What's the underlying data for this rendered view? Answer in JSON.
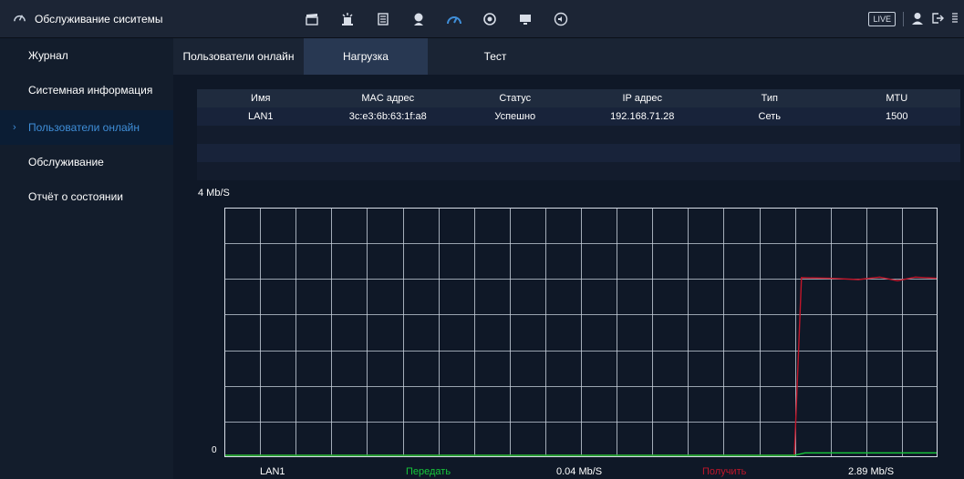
{
  "header": {
    "title": "Обслуживание сиситемы",
    "toolbar_icons": [
      "clapper-icon",
      "alarm-icon",
      "storage-icon",
      "user-icon",
      "gauge-icon",
      "network-icon",
      "monitor-icon",
      "audio-icon"
    ],
    "live_label": "LIVE"
  },
  "sidebar": {
    "items": [
      {
        "label": "Журнал",
        "active": false
      },
      {
        "label": "Системная информация",
        "active": false
      },
      {
        "label": "Пользователи онлайн",
        "active": true
      },
      {
        "label": "Обслуживание",
        "active": false
      },
      {
        "label": "Отчёт о состоянии",
        "active": false
      }
    ],
    "chevron": "›"
  },
  "tabs": [
    {
      "label": "Пользователи онлайн",
      "active": false
    },
    {
      "label": "Нагрузка",
      "active": true
    },
    {
      "label": "Тест",
      "active": false
    }
  ],
  "table": {
    "columns": [
      "Имя",
      "MAC адрес",
      "Статус",
      "IP адрес",
      "Тип",
      "MTU"
    ],
    "rows": [
      [
        "LAN1",
        "3c:e3:6b:63:1f:a8",
        "Успешно",
        "192.168.71.28",
        "Сеть",
        "1500"
      ]
    ]
  },
  "chart": {
    "max_label": "4 Mb/S",
    "zero_label": "0"
  },
  "chart_data": {
    "type": "line",
    "ylim": [
      0,
      4
    ],
    "y_unit": "Mb/S",
    "x_samples": 200,
    "series": [
      {
        "name": "Получить",
        "color": "#c0162a",
        "points": [
          [
            0,
            0
          ],
          [
            160,
            0
          ],
          [
            162,
            2.89
          ],
          [
            170,
            2.88
          ],
          [
            178,
            2.86
          ],
          [
            184,
            2.9
          ],
          [
            189,
            2.84
          ],
          [
            194,
            2.9
          ],
          [
            200,
            2.88
          ]
        ]
      },
      {
        "name": "Передать",
        "color": "#16c83a",
        "points": [
          [
            0,
            0
          ],
          [
            160,
            0
          ],
          [
            163,
            0.04
          ],
          [
            200,
            0.04
          ]
        ]
      }
    ]
  },
  "legend": {
    "interface": "LAN1",
    "send_label": "Передать",
    "send_value": "0.04 Mb/S",
    "receive_label": "Получить",
    "receive_value": "2.89 Mb/S"
  },
  "colors": {
    "accent": "#3f8ed8",
    "send": "#16c83a",
    "receive": "#c0162a"
  }
}
